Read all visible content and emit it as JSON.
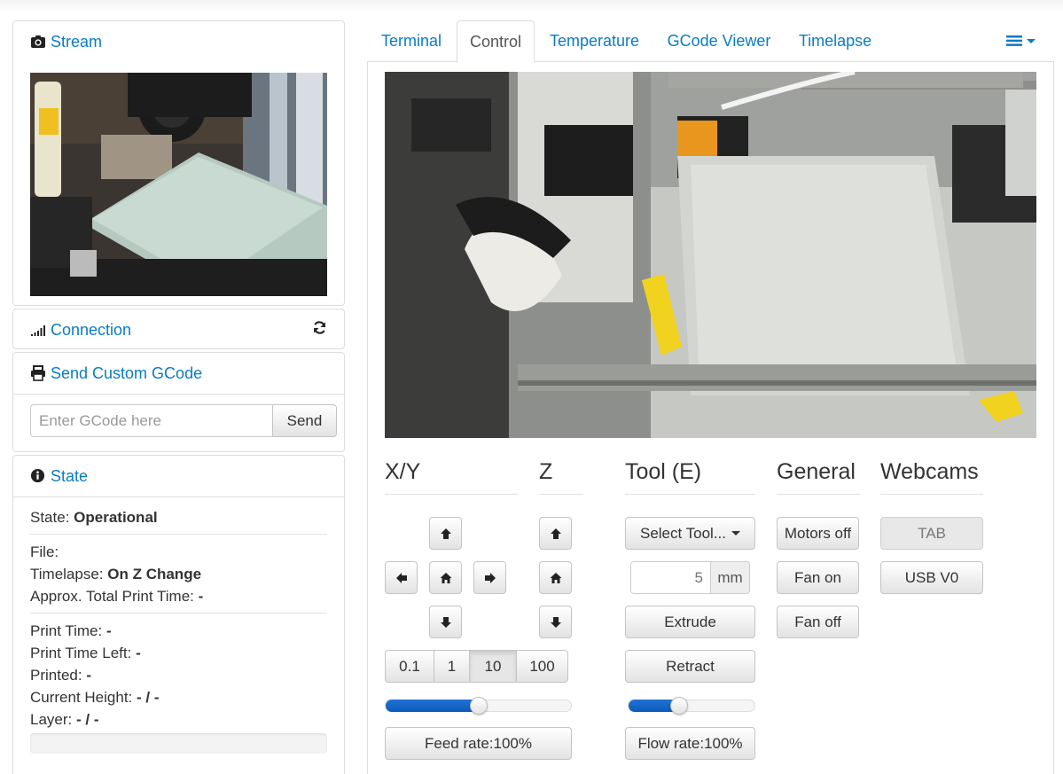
{
  "sidebar": {
    "stream": {
      "title": "Stream",
      "icon": "camera-icon"
    },
    "connection": {
      "title": "Connection",
      "icon": "signal-icon",
      "refresh_icon": "refresh-icon"
    },
    "gcode": {
      "title": "Send Custom GCode",
      "icon": "printer-icon",
      "placeholder": "Enter GCode here",
      "send_label": "Send"
    },
    "state": {
      "title": "State",
      "icon": "info-icon",
      "state_label": "State:",
      "state_value": "Operational",
      "file_label": "File:",
      "timelapse_label": "Timelapse:",
      "timelapse_value": "On Z Change",
      "approx_label": "Approx. Total Print Time:",
      "approx_value": "-",
      "print_time_label": "Print Time:",
      "print_time_value": "-",
      "time_left_label": "Print Time Left:",
      "time_left_value": "-",
      "printed_label": "Printed:",
      "printed_value": "-",
      "height_label": "Current Height:",
      "height_value": "- / -",
      "layer_label": "Layer:",
      "layer_value": "- / -",
      "progress": 0
    }
  },
  "tabs": [
    {
      "label": "Terminal",
      "active": false
    },
    {
      "label": "Control",
      "active": true
    },
    {
      "label": "Temperature",
      "active": false
    },
    {
      "label": "GCode Viewer",
      "active": false
    },
    {
      "label": "Timelapse",
      "active": false
    }
  ],
  "control": {
    "xy": {
      "title": "X/Y"
    },
    "z": {
      "title": "Z"
    },
    "tool": {
      "title": "Tool (E)",
      "select_label": "Select Tool...",
      "amount_value": "5",
      "amount_unit": "mm",
      "extrude_label": "Extrude",
      "retract_label": "Retract",
      "flow_label": "Flow rate:100%",
      "flow_fraction": 0.4
    },
    "general": {
      "title": "General",
      "motors_off_label": "Motors off",
      "fan_on_label": "Fan on",
      "fan_off_label": "Fan off"
    },
    "webcams": {
      "title": "Webcams",
      "tab_label": "TAB",
      "usb_label": "USB V0"
    },
    "steps": [
      "0.1",
      "1",
      "10",
      "100"
    ],
    "active_step": "10",
    "feed_label": "Feed rate:100%",
    "feed_fraction": 0.5
  },
  "colors": {
    "link": "#0a7cc1",
    "slider": "#1565c8"
  }
}
